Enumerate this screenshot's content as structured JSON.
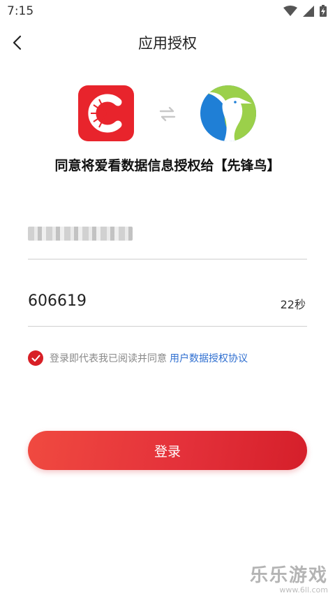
{
  "status_bar": {
    "time": "7:15"
  },
  "header": {
    "title": "应用授权"
  },
  "authorize": {
    "text": "同意将爱看数据信息授权给【先锋鸟】"
  },
  "form": {
    "phone_value": "",
    "code_value": "606619",
    "countdown": "22秒"
  },
  "agreement": {
    "text": "登录即代表我已阅读并同意",
    "link": "用户数据授权协议"
  },
  "login_button": {
    "label": "登录"
  },
  "watermark": {
    "title": "乐乐游戏",
    "url": "www.6ll.com"
  },
  "colors": {
    "brand_red": "#d81f26",
    "link_blue": "#2f6fd0",
    "bird_blue": "#1f7fd6",
    "bird_green": "#9bd04a"
  }
}
